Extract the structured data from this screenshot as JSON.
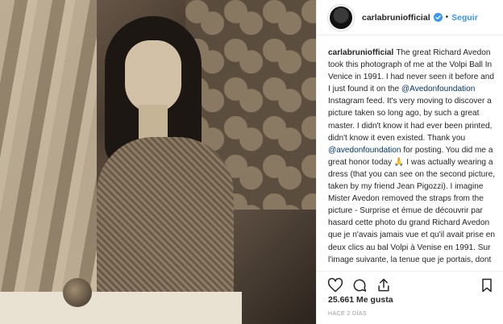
{
  "post": {
    "username": "carlabrunio​fficial",
    "follow_label": "Seguir",
    "separator": "•",
    "caption_user": "carlabrunio​fficial",
    "caption_parts": [
      {
        "text": "The great Richard Avedon took this photograph of me at the Volpi Ball In Venice in 1991. I had never seen it before and I just found it on the "
      },
      {
        "text": "@Avedonfoundation",
        "mention": true
      },
      {
        "text": " Instagram feed. It's very moving to discover a picture taken so long ago, by such a great master. I didn't know it had ever been printed, didn't know it even existed. Thank you "
      },
      {
        "text": "@avedonfoundation",
        "mention": true
      },
      {
        "text": " for posting. You did me a great honor today 🙏 I was actually wearing a dress (that you can see on the second picture, taken by my friend Jean Pigozzi). I imagine Mister Avedon removed the straps from the picture - Surprise et émue de découvrir par hasard cette photo du grand Richard Avedon que je n'avais jamais vue et qu'il avait prise en deux clics au bal Volpi à Venise en 1991. Sur l'image suivante, la tenue que je portais, dont les"
      }
    ],
    "likes": "25.661 Me gusta",
    "time": "HACE 2 DÍAS"
  },
  "icons": {
    "avatar": "profile-avatar",
    "verified": "verified-badge-icon",
    "like": "heart-icon",
    "comment": "comment-icon",
    "share": "share-icon",
    "save": "bookmark-icon"
  },
  "colors": {
    "follow": "#3897f0",
    "verified": "#3897f0",
    "text": "#262626",
    "muted": "#999999",
    "mention": "#003569"
  }
}
